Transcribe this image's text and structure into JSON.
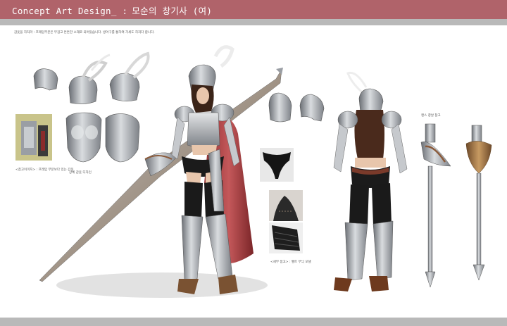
{
  "header": {
    "title": "Concept Art Design_ :",
    "subtitle": "모순의 창기사 (여)",
    "bar_color": "#b0636a",
    "strip_color": "#b9b9b9"
  },
  "description": "갑옷을 하처라 : 프레임부분은 무겁고 튼튼한 소재로 되어있습니다. 방어구를 통하여 가세도 하처다 합니다.",
  "captions": {
    "reference": "<참고이미지> : 프레임 부분보다 있는 갑옷",
    "armor": "상체 갑옷 디자인",
    "detail": "<세부 참고> : 벨트 무늬 모델",
    "lance": "랜스 창날 참고"
  }
}
